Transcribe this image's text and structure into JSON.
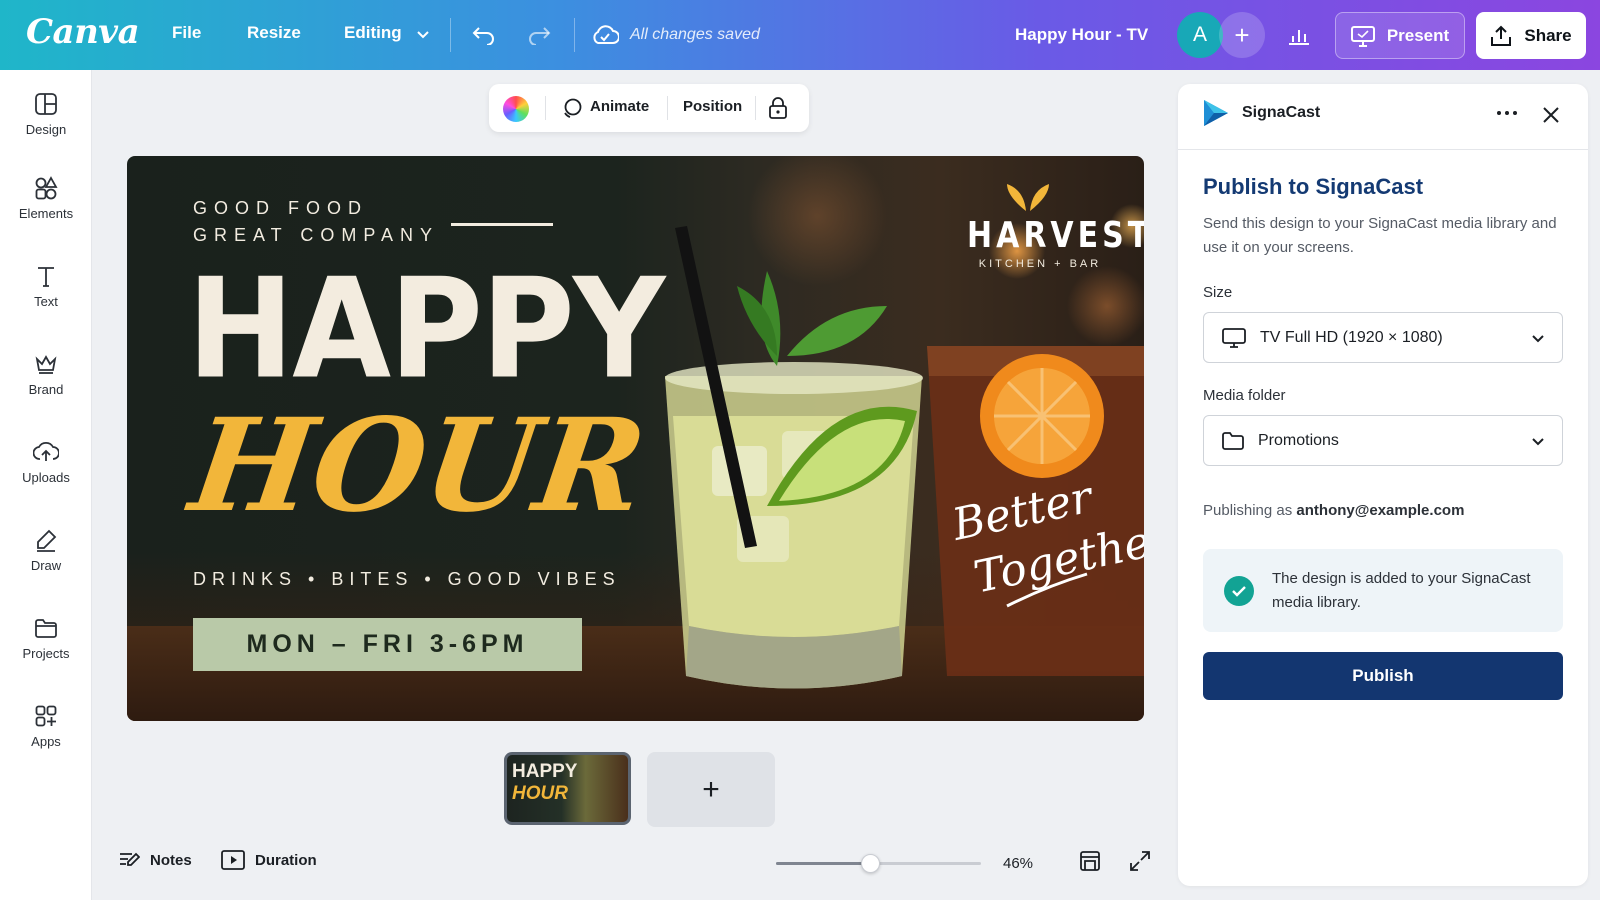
{
  "topbar": {
    "logo": "Canva",
    "menu": {
      "file": "File",
      "resize": "Resize",
      "editing": "Editing"
    },
    "save_status": "All changes saved",
    "doc_title": "Happy Hour - TV",
    "avatar_initial": "A",
    "present_label": "Present",
    "share_label": "Share"
  },
  "rail": {
    "items": [
      {
        "label": "Design",
        "icon": "layout-icon"
      },
      {
        "label": "Elements",
        "icon": "shapes-icon"
      },
      {
        "label": "Text",
        "icon": "text-icon"
      },
      {
        "label": "Brand",
        "icon": "crown-icon"
      },
      {
        "label": "Uploads",
        "icon": "cloud-upload-icon"
      },
      {
        "label": "Draw",
        "icon": "pen-icon"
      },
      {
        "label": "Projects",
        "icon": "folder-icon"
      },
      {
        "label": "Apps",
        "icon": "apps-icon"
      }
    ]
  },
  "context_toolbar": {
    "animate": "Animate",
    "position": "Position"
  },
  "design": {
    "tagline_1": "GOOD FOOD",
    "tagline_2": "GREAT COMPANY",
    "headline_1": "HAPPY",
    "headline_2": "HOUR",
    "subline": "DRINKS  •  BITES  •  GOOD VIBES",
    "days": "MON – FRI  3-6PM",
    "brand_name": "HARVEST",
    "brand_sub": "KITCHEN + BAR",
    "script_1": "Better",
    "script_2": "Together"
  },
  "pages": {
    "thumb_1": "HAPPY",
    "thumb_2": "HOUR",
    "add_page": "+"
  },
  "bottom": {
    "notes": "Notes",
    "duration": "Duration",
    "zoom_value": "46%",
    "zoom_fraction": 0.46
  },
  "panel": {
    "app_name": "SignaCast",
    "title": "Publish to SignaCast",
    "description": "Send this design to your SignaCast media library and use it on your screens.",
    "size_label": "Size",
    "size_value": "TV Full HD (1920 × 1080)",
    "folder_label": "Media folder",
    "folder_value": "Promotions",
    "publishing_as_prefix": "Publishing as",
    "publishing_as_email": "anthony@example.com",
    "success_message": "The design is added to your SignaCast media library.",
    "publish_label": "Publish"
  },
  "colors": {
    "brand_navy": "#133670",
    "success_teal": "#12a394",
    "headline_gold": "#f2b63a",
    "days_sage": "#b9c9a8"
  }
}
